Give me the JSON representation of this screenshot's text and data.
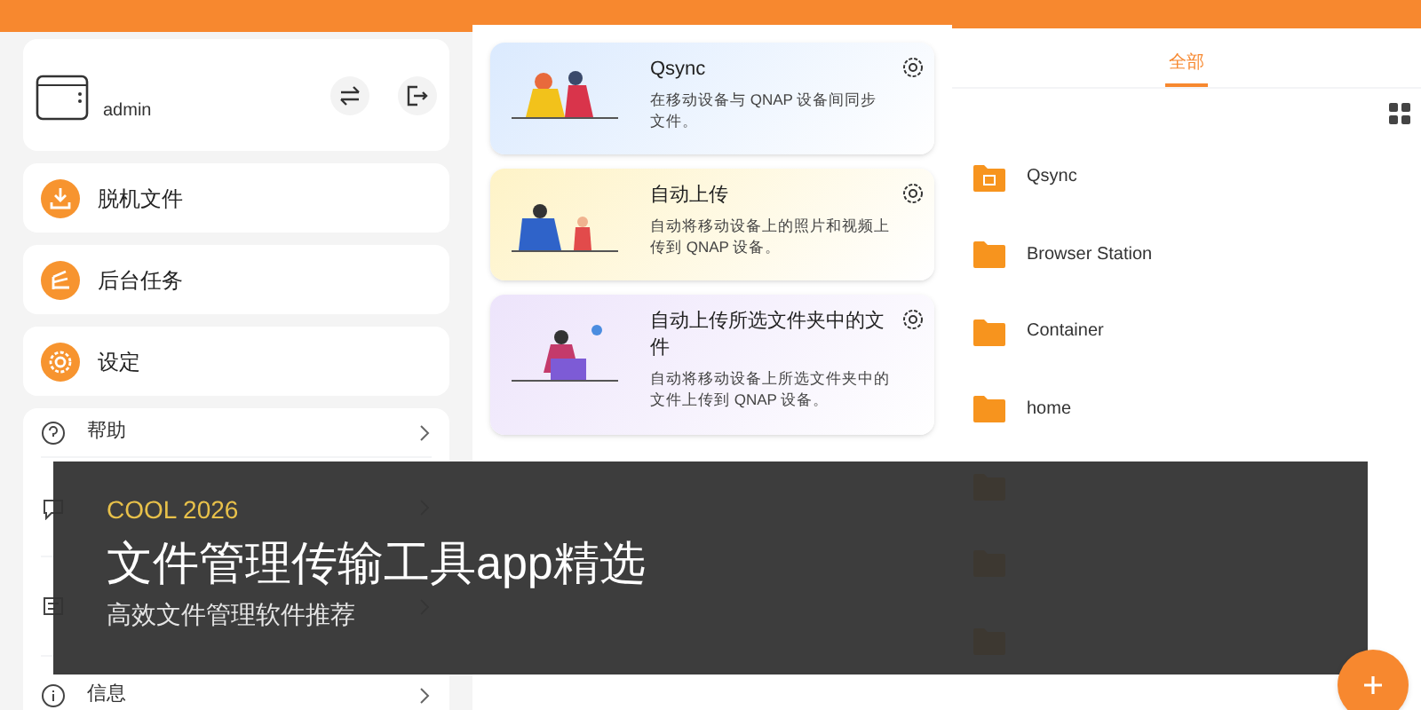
{
  "menu_panel": {
    "account": {
      "user": "admin"
    },
    "shortcuts": [
      {
        "kind": "download",
        "label": "脱机文件"
      },
      {
        "kind": "tasks",
        "label": "后台任务"
      },
      {
        "kind": "settings",
        "label": "设定"
      }
    ],
    "links": [
      {
        "kind": "help",
        "label": "帮助"
      },
      {
        "kind": "faq"
      },
      {
        "kind": "feedback"
      },
      {
        "kind": "info",
        "label": "信息"
      }
    ]
  },
  "sync_panel": {
    "cards": [
      {
        "title": "Qsync",
        "description": "在移动设备与 QNAP 设备间同步文件。",
        "color": "#dbeafe"
      },
      {
        "title": "自动上传",
        "description": "自动将移动设备上的照片和视频上传到 QNAP 设备。",
        "color": "#fef3c7"
      },
      {
        "title": "自动上传所选文件夹中的文件",
        "description": "自动将移动设备上所选文件夹中的文件上传到 QNAP 设备。",
        "color": "#ede4fb"
      }
    ]
  },
  "folders_panel": {
    "tabs": [
      {
        "label": "全部",
        "selected": true
      }
    ],
    "folders": [
      {
        "name": "Qsync",
        "kind": "special"
      },
      {
        "name": "Browser Station",
        "kind": "plain"
      },
      {
        "name": "Container",
        "kind": "plain"
      },
      {
        "name": "home",
        "kind": "plain"
      },
      {
        "kind": "plain"
      },
      {
        "kind": "plain"
      },
      {
        "kind": "plain"
      }
    ]
  },
  "banner": {
    "tag": "COOL 2026",
    "title": "文件管理传输工具app精选",
    "subtitle": "高效文件管理软件推荐"
  }
}
